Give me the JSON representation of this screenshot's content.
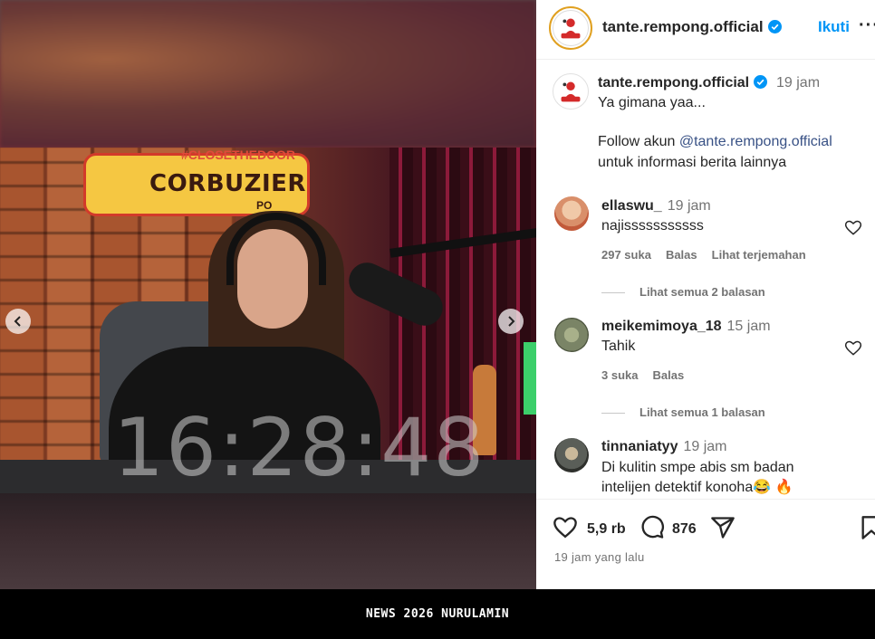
{
  "media": {
    "sign_tag": "#CLOSETHEDOOR",
    "sign_title": "CORBUZIER",
    "sign_sub": "PO",
    "timestamp_overlay": "16:28:48"
  },
  "header": {
    "username": "tante.rempong.official",
    "follow_label": "Ikuti",
    "more_label": "···"
  },
  "caption": {
    "username": "tante.rempong.official",
    "time": "19 jam",
    "line1": "Ya gimana yaa...",
    "line2_prefix": "Follow akun ",
    "line2_mention": "@tante.rempong.official",
    "line3": "untuk informasi berita lainnya"
  },
  "comments": [
    {
      "username": "ellaswu_",
      "time": "19 jam",
      "text": "najisssssssssss",
      "likes": "297 suka",
      "reply": "Balas",
      "translate": "Lihat terjemahan",
      "view_replies": "Lihat semua 2 balasan",
      "avatar_color": "#d98f6a"
    },
    {
      "username": "meikemimoya_18",
      "time": "15 jam",
      "text": "Tahik",
      "likes": "3 suka",
      "reply": "Balas",
      "view_replies": "Lihat semua 1 balasan",
      "avatar_color": "#7a8466"
    },
    {
      "username": "tinnaniatyy",
      "time": "19 jam",
      "text_line1": "Di kulitin smpe abis sm badan",
      "text_line2": "intelijen detektif konoha😂 🔥",
      "avatar_color": "#5a5e58"
    }
  ],
  "actions": {
    "likes_count": "5,9 rb",
    "comments_count": "876",
    "posted_time": "19 jam yang lalu"
  },
  "footer": {
    "text": "NEWS 2026 NURULAMIN"
  },
  "colors": {
    "accent": "#0095f6",
    "verified": "#0095f6",
    "mention": "#385185"
  }
}
